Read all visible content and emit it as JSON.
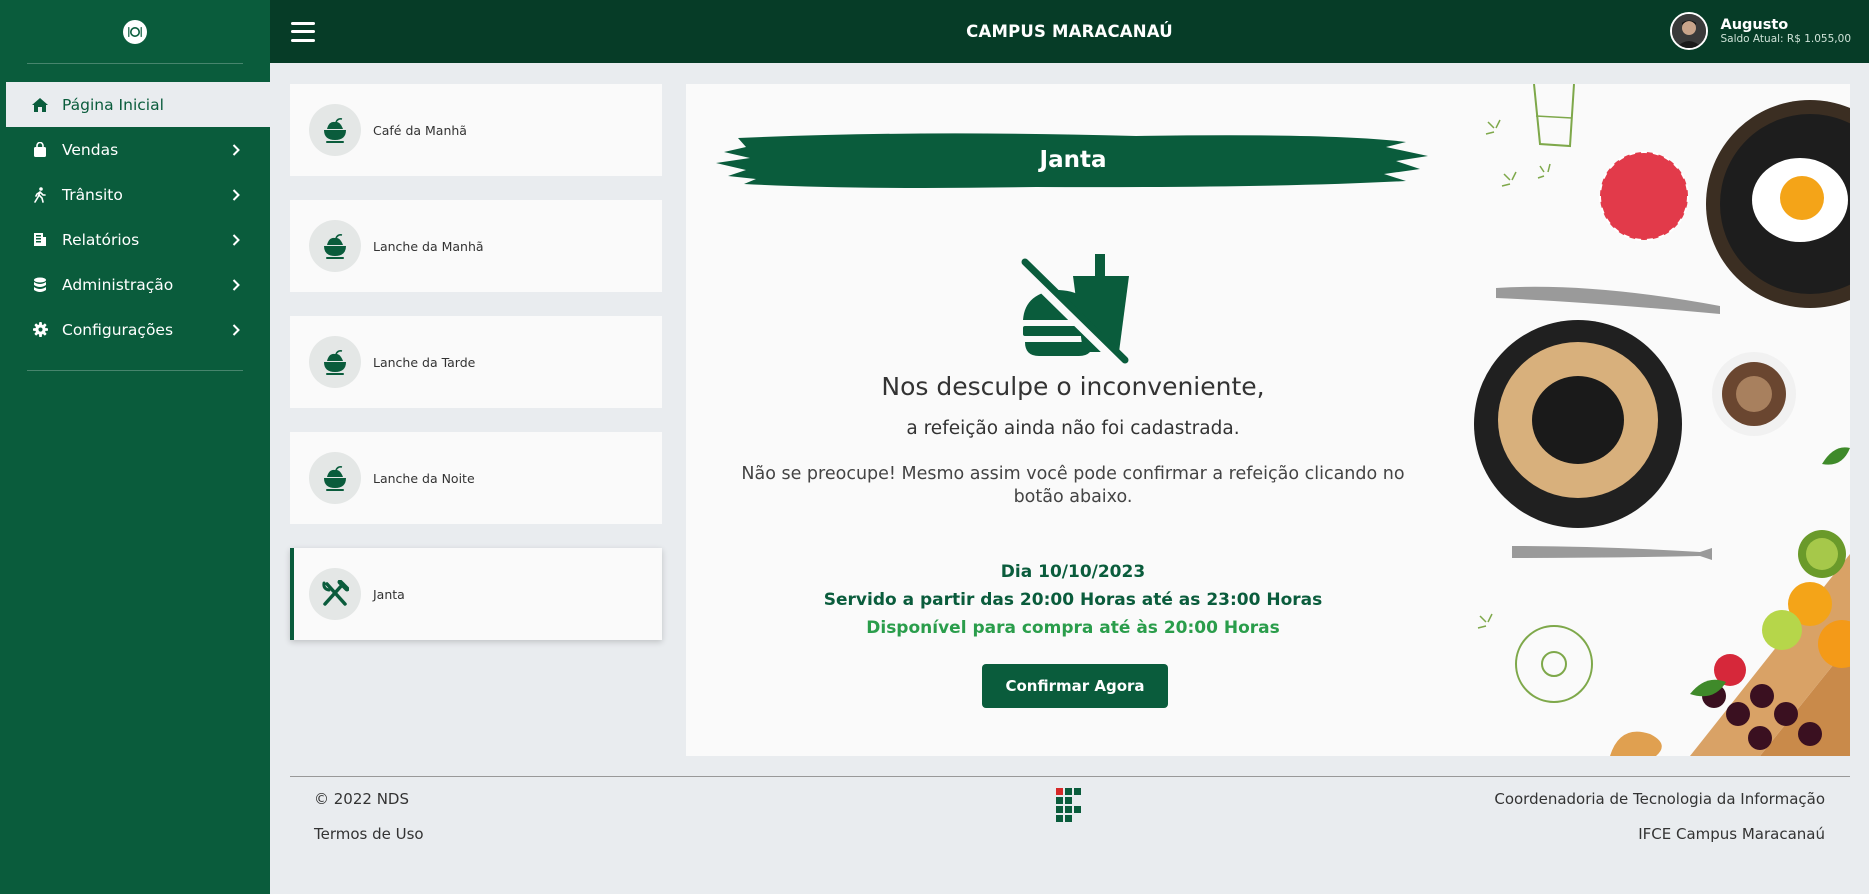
{
  "colors": {
    "primary": "#0a5c3c",
    "topbar": "#063c27",
    "accent_green": "#2a9d4b",
    "background": "#e9ecef"
  },
  "header": {
    "title": "CAMPUS MARACANAÚ",
    "user_name": "Augusto",
    "user_balance": "Saldo Atual: R$ 1.055,00"
  },
  "sidebar": {
    "items": [
      {
        "label": "Página Inicial",
        "icon": "home-icon",
        "active": true
      },
      {
        "label": "Vendas",
        "icon": "shopping-bag-icon"
      },
      {
        "label": "Trânsito",
        "icon": "walking-icon"
      },
      {
        "label": "Relatórios",
        "icon": "report-icon"
      },
      {
        "label": "Administração",
        "icon": "database-icon"
      },
      {
        "label": "Configurações",
        "icon": "gear-icon"
      }
    ]
  },
  "meals": [
    {
      "label": "Café da Manhã",
      "icon": "food-bowl-icon"
    },
    {
      "label": "Lanche da Manhã",
      "icon": "food-bowl-icon"
    },
    {
      "label": "Lanche da Tarde",
      "icon": "food-bowl-icon"
    },
    {
      "label": "Lanche da Noite",
      "icon": "food-bowl-icon"
    },
    {
      "label": "Janta",
      "icon": "utensils-icon",
      "active": true
    }
  ],
  "main": {
    "title": "Janta",
    "sorry_title": "Nos desculpe o inconveniente,",
    "sorry_subtitle": "a refeição ainda não foi cadastrada.",
    "sorry_info": "Não se preocupe! Mesmo assim você pode confirmar a refeição clicando no botão abaixo.",
    "date": "Dia 10/10/2023",
    "served": "Servido a partir das 20:00 Horas até as 23:00 Horas",
    "available": "Disponível para compra até às 20:00 Horas",
    "confirm_label": "Confirmar Agora"
  },
  "footer": {
    "copyright": "© 2022 NDS",
    "terms": "Termos de Uso",
    "dept": "Coordenadoria de Tecnologia da Informação",
    "campus": "IFCE Campus Maracanaú"
  }
}
